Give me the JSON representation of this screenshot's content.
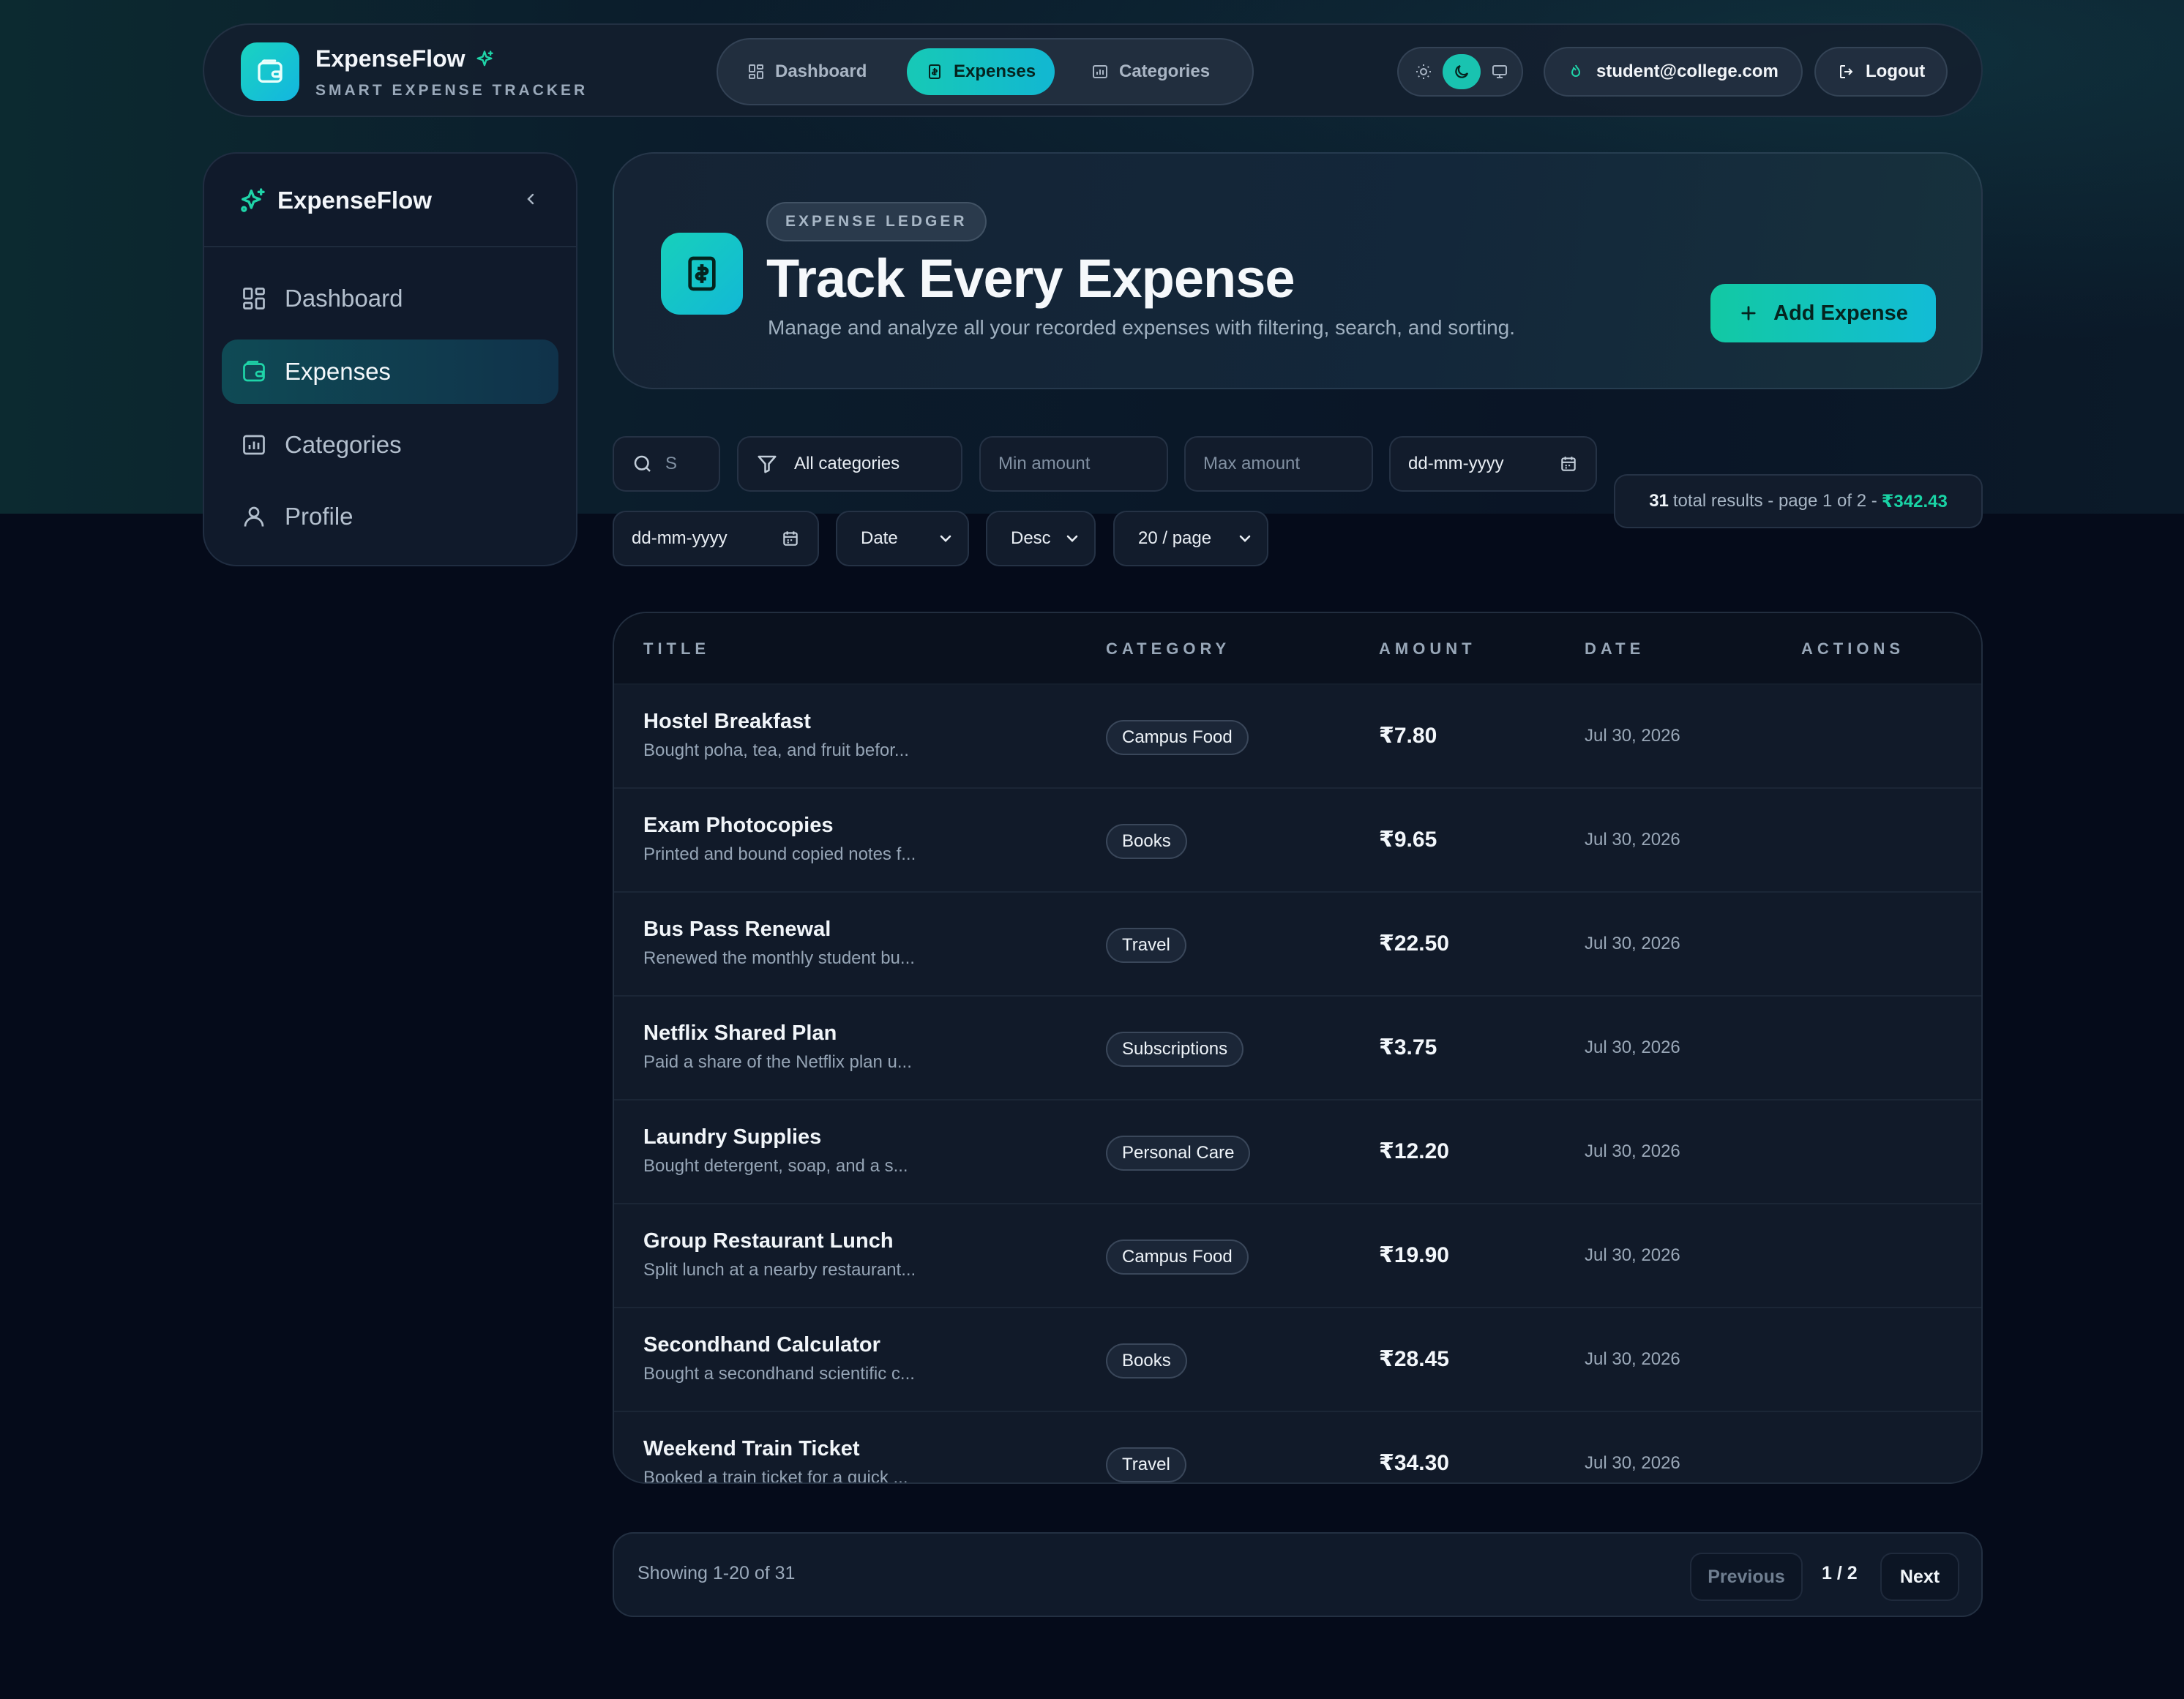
{
  "colors": {
    "accent": "#17c9b6",
    "accent_alt": "#12b7d2",
    "background": "#050b1a",
    "money_green": "#19d3a5"
  },
  "header": {
    "brand_title": "ExpenseFlow",
    "brand_subtitle": "SMART EXPENSE TRACKER",
    "nav": [
      {
        "label": "Dashboard",
        "icon": "grid-icon"
      },
      {
        "label": "Expenses",
        "icon": "receipt-icon",
        "active": true
      },
      {
        "label": "Categories",
        "icon": "chart-folder-icon"
      }
    ],
    "theme_options": [
      "sun-icon",
      "moon-icon",
      "monitor-icon"
    ],
    "active_theme": "moon-icon",
    "user_email": "student@college.com",
    "logout_label": "Logout"
  },
  "sidebar": {
    "brand": "ExpenseFlow",
    "items": [
      {
        "label": "Dashboard",
        "icon": "grid-icon"
      },
      {
        "label": "Expenses",
        "icon": "wallet-icon",
        "active": true
      },
      {
        "label": "Categories",
        "icon": "chart-folder-icon"
      },
      {
        "label": "Profile",
        "icon": "user-icon"
      }
    ]
  },
  "hero": {
    "badge": "EXPENSE LEDGER",
    "title": "Track Every Expense",
    "subtitle": "Manage and analyze all your recorded expenses with filtering, search, and sorting.",
    "add_button": "Add Expense"
  },
  "filters": {
    "search_value": "S",
    "category": "All categories",
    "min_amount_placeholder": "Min amount",
    "max_amount_placeholder": "Max amount",
    "date_from": "dd-mm-yyyy",
    "date_to": "dd-mm-yyyy",
    "sort_field": "Date",
    "sort_order": "Desc",
    "page_size": "20 / page"
  },
  "results": {
    "count": "31",
    "text": "total results - page 1 of 2 -",
    "total": "₹342.43"
  },
  "table": {
    "columns": [
      "TITLE",
      "CATEGORY",
      "AMOUNT",
      "DATE",
      "ACTIONS"
    ],
    "rows": [
      {
        "title": "Hostel Breakfast",
        "desc": "Bought poha, tea, and fruit befor...",
        "category": "Campus Food",
        "amount": "₹7.80",
        "date": "Jul 30, 2026"
      },
      {
        "title": "Exam Photocopies",
        "desc": "Printed and bound copied notes f...",
        "category": "Books",
        "amount": "₹9.65",
        "date": "Jul 30, 2026"
      },
      {
        "title": "Bus Pass Renewal",
        "desc": "Renewed the monthly student bu...",
        "category": "Travel",
        "amount": "₹22.50",
        "date": "Jul 30, 2026"
      },
      {
        "title": "Netflix Shared Plan",
        "desc": "Paid a share of the Netflix plan u...",
        "category": "Subscriptions",
        "amount": "₹3.75",
        "date": "Jul 30, 2026"
      },
      {
        "title": "Laundry Supplies",
        "desc": "Bought detergent, soap, and a s...",
        "category": "Personal Care",
        "amount": "₹12.20",
        "date": "Jul 30, 2026"
      },
      {
        "title": "Group Restaurant Lunch",
        "desc": "Split lunch at a nearby restaurant...",
        "category": "Campus Food",
        "amount": "₹19.90",
        "date": "Jul 30, 2026"
      },
      {
        "title": "Secondhand Calculator",
        "desc": "Bought a secondhand scientific c...",
        "category": "Books",
        "amount": "₹28.45",
        "date": "Jul 30, 2026"
      },
      {
        "title": "Weekend Train Ticket",
        "desc": "Booked a train ticket for a quick ...",
        "category": "Travel",
        "amount": "₹34.30",
        "date": "Jul 30, 2026"
      }
    ]
  },
  "pagination": {
    "showing": "Showing 1-20 of 31",
    "previous": "Previous",
    "page": "1 / 2",
    "next": "Next"
  }
}
